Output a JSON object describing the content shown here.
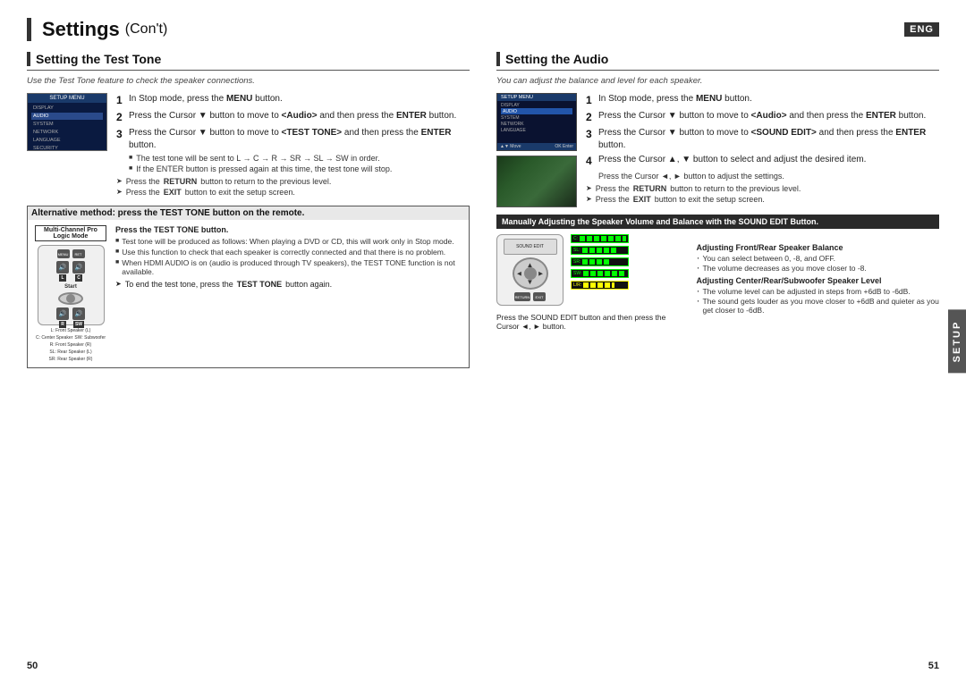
{
  "header": {
    "title": "Settings",
    "subtitle": "(Con't)",
    "eng_badge": "ENG"
  },
  "left_section": {
    "title": "Setting the Test Tone",
    "subtitle": "Use the Test Tone feature to check the speaker connections.",
    "steps": [
      {
        "num": "1",
        "text": "In Stop mode, press the ",
        "bold": "MENU",
        "text2": " button."
      },
      {
        "num": "2",
        "text": "Press the Cursor ▼ button to move to <Audio> and then press the ",
        "bold": "ENTER",
        "text2": " button."
      },
      {
        "num": "3",
        "text": "Press the Cursor ▼ button to move to <TEST TONE> and then press the ",
        "bold": "ENTER",
        "text2": " button."
      }
    ],
    "bullets": [
      "The test tone will be sent to L → C → R → SR → SL → SW in order.",
      "If the ENTER button is pressed again at this time, the test tone will stop."
    ],
    "arrows": [
      "Press the RETURN button to return to the previous level.",
      "Press the EXIT button to exit the setup screen."
    ],
    "alt_method": {
      "title": "Alternative method: press the TEST TONE button on the remote.",
      "diagram_title": "Multi-Channel Pro Logic Mode",
      "steps_title": "Press the TEST TONE button.",
      "bullets": [
        "Test tone will be produced as follows: When playing a DVD or CD, this will work only in Stop mode.",
        "Use this function to check that each speaker is correctly connected and that there is no problem.",
        "When HDMI AUDIO is on (audio is produced through TV speakers), the TEST TONE function is not available."
      ],
      "arrow": "To end the test tone, press the TEST TONE button again.",
      "speaker_labels": [
        "L: Front Speaker (L)",
        "C: Center Speaker",
        "SW: Subwoofer",
        "R: Front Speaker (R)",
        "SL: Rear Speaker (L)",
        "SR: Rear Speaker (R)"
      ]
    }
  },
  "right_section": {
    "title": "Setting the Audio",
    "subtitle": "You can adjust the balance and level for each speaker.",
    "steps": [
      {
        "num": "1",
        "text": "In Stop mode, press the ",
        "bold": "MENU",
        "text2": " button."
      },
      {
        "num": "2",
        "text": "Press the Cursor ▼ button to move to <Audio> and then press the ",
        "bold": "ENTER",
        "text2": " button."
      },
      {
        "num": "3",
        "text": "Press the Cursor ▼ button to move to <SOUND EDIT> and then press the ",
        "bold": "ENTER",
        "text2": " button."
      },
      {
        "num": "4",
        "text": "Press the Cursor ▲, ▼ button to select and adjust the desired item."
      }
    ],
    "cursor_note": "Press the Cursor ◄, ► button to adjust the settings.",
    "arrows": [
      "Press the RETURN button to return to the previous level.",
      "Press the EXIT button to exit the setup screen."
    ],
    "sound_edit": {
      "title": "Manually Adjusting the Speaker Volume and Balance with the SOUND EDIT Button.",
      "instruction": "Press the SOUND EDIT button and then press the Cursor ◄, ► button.",
      "adjusting_front": {
        "title": "Adjusting Front/Rear Speaker Balance",
        "bullets": [
          "You can select between 0, -8, and OFF.",
          "The volume decreases as you move closer to -8."
        ]
      },
      "adjusting_center": {
        "title": "Adjusting Center/Rear/Subwoofer Speaker Level",
        "bullets": [
          "The volume level can be adjusted in steps from +6dB to -6dB.",
          "The sound gets louder as you move closer to +6dB and quieter as you get closer to -6dB."
        ]
      }
    }
  },
  "page_numbers": {
    "left": "50",
    "right": "51"
  },
  "setup_tab": "SETUP"
}
